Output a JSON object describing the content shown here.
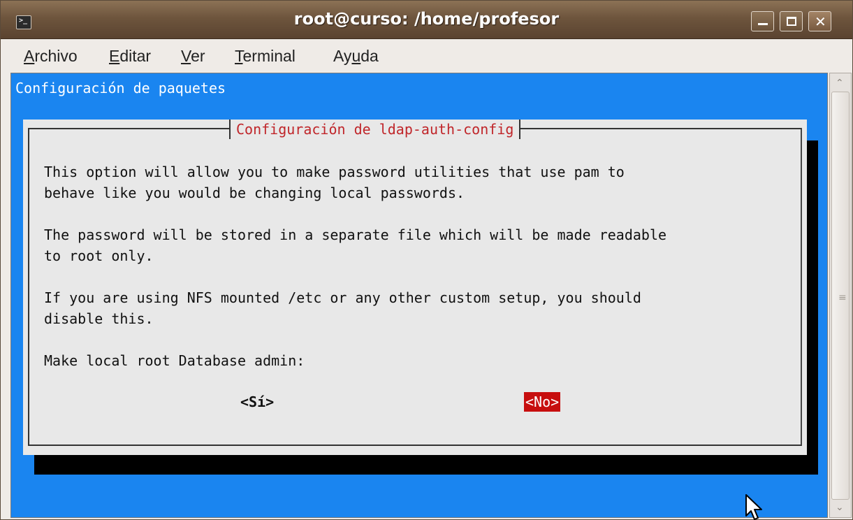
{
  "window": {
    "title": "root@curso: /home/profesor",
    "minimize_icon": "minimize-icon",
    "maximize_icon": "maximize-icon",
    "close_icon": "close-icon"
  },
  "menubar": {
    "items": [
      {
        "pre": "",
        "mnemonic": "A",
        "post": "rchivo"
      },
      {
        "pre": "",
        "mnemonic": "E",
        "post": "ditar"
      },
      {
        "pre": "",
        "mnemonic": "V",
        "post": "er"
      },
      {
        "pre": "",
        "mnemonic": "T",
        "post": "erminal"
      },
      {
        "pre": "Ay",
        "mnemonic": "u",
        "post": "da"
      }
    ]
  },
  "terminal": {
    "backtitle": "Configuración de paquetes",
    "dialog": {
      "title": "Configuración de ldap-auth-config",
      "lines": [
        "This option will allow you to make password utilities that use pam to",
        "behave like you would be changing local passwords.",
        "The password will be stored in a separate file which will be made readable",
        "to root only.",
        "If you are using NFS mounted /etc or any other custom setup, you should",
        "disable this.",
        "Make local root Database admin:"
      ],
      "button_yes": "<Sí>",
      "button_no": "<No>",
      "selected_button": "<No>"
    }
  },
  "colors": {
    "terminal_background": "#1a85f0",
    "dialog_background": "#e8e8e8",
    "dialog_title": "#c0262a",
    "selected_button": "#c70e0e",
    "titlebar": "#6e553d"
  }
}
